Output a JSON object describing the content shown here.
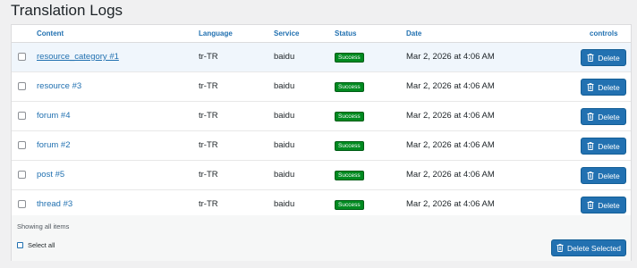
{
  "page": {
    "title": "Translation Logs"
  },
  "table": {
    "headers": {
      "content": "Content",
      "language": "Language",
      "service": "Service",
      "status": "Status",
      "date": "Date",
      "controls": "controls"
    },
    "rows": [
      {
        "content": "resource_category #1",
        "language": "tr-TR",
        "service": "baidu",
        "status": "Success",
        "date": "Mar 2, 2026 at 4:06 AM",
        "action": "Delete"
      },
      {
        "content": "resource #3",
        "language": "tr-TR",
        "service": "baidu",
        "status": "Success",
        "date": "Mar 2, 2026 at 4:06 AM",
        "action": "Delete"
      },
      {
        "content": "forum #4",
        "language": "tr-TR",
        "service": "baidu",
        "status": "Success",
        "date": "Mar 2, 2026 at 4:06 AM",
        "action": "Delete"
      },
      {
        "content": "forum #2",
        "language": "tr-TR",
        "service": "baidu",
        "status": "Success",
        "date": "Mar 2, 2026 at 4:06 AM",
        "action": "Delete"
      },
      {
        "content": "post #5",
        "language": "tr-TR",
        "service": "baidu",
        "status": "Success",
        "date": "Mar 2, 2026 at 4:06 AM",
        "action": "Delete"
      },
      {
        "content": "thread #3",
        "language": "tr-TR",
        "service": "baidu",
        "status": "Success",
        "date": "Mar 2, 2026 at 4:06 AM",
        "action": "Delete"
      }
    ]
  },
  "footer": {
    "showing": "Showing all items",
    "select_all": "Select all",
    "delete_selected": "Delete Selected"
  },
  "colors": {
    "accent": "#2271b1",
    "success": "#008a20"
  },
  "icons": {
    "delete": "trash-icon"
  }
}
